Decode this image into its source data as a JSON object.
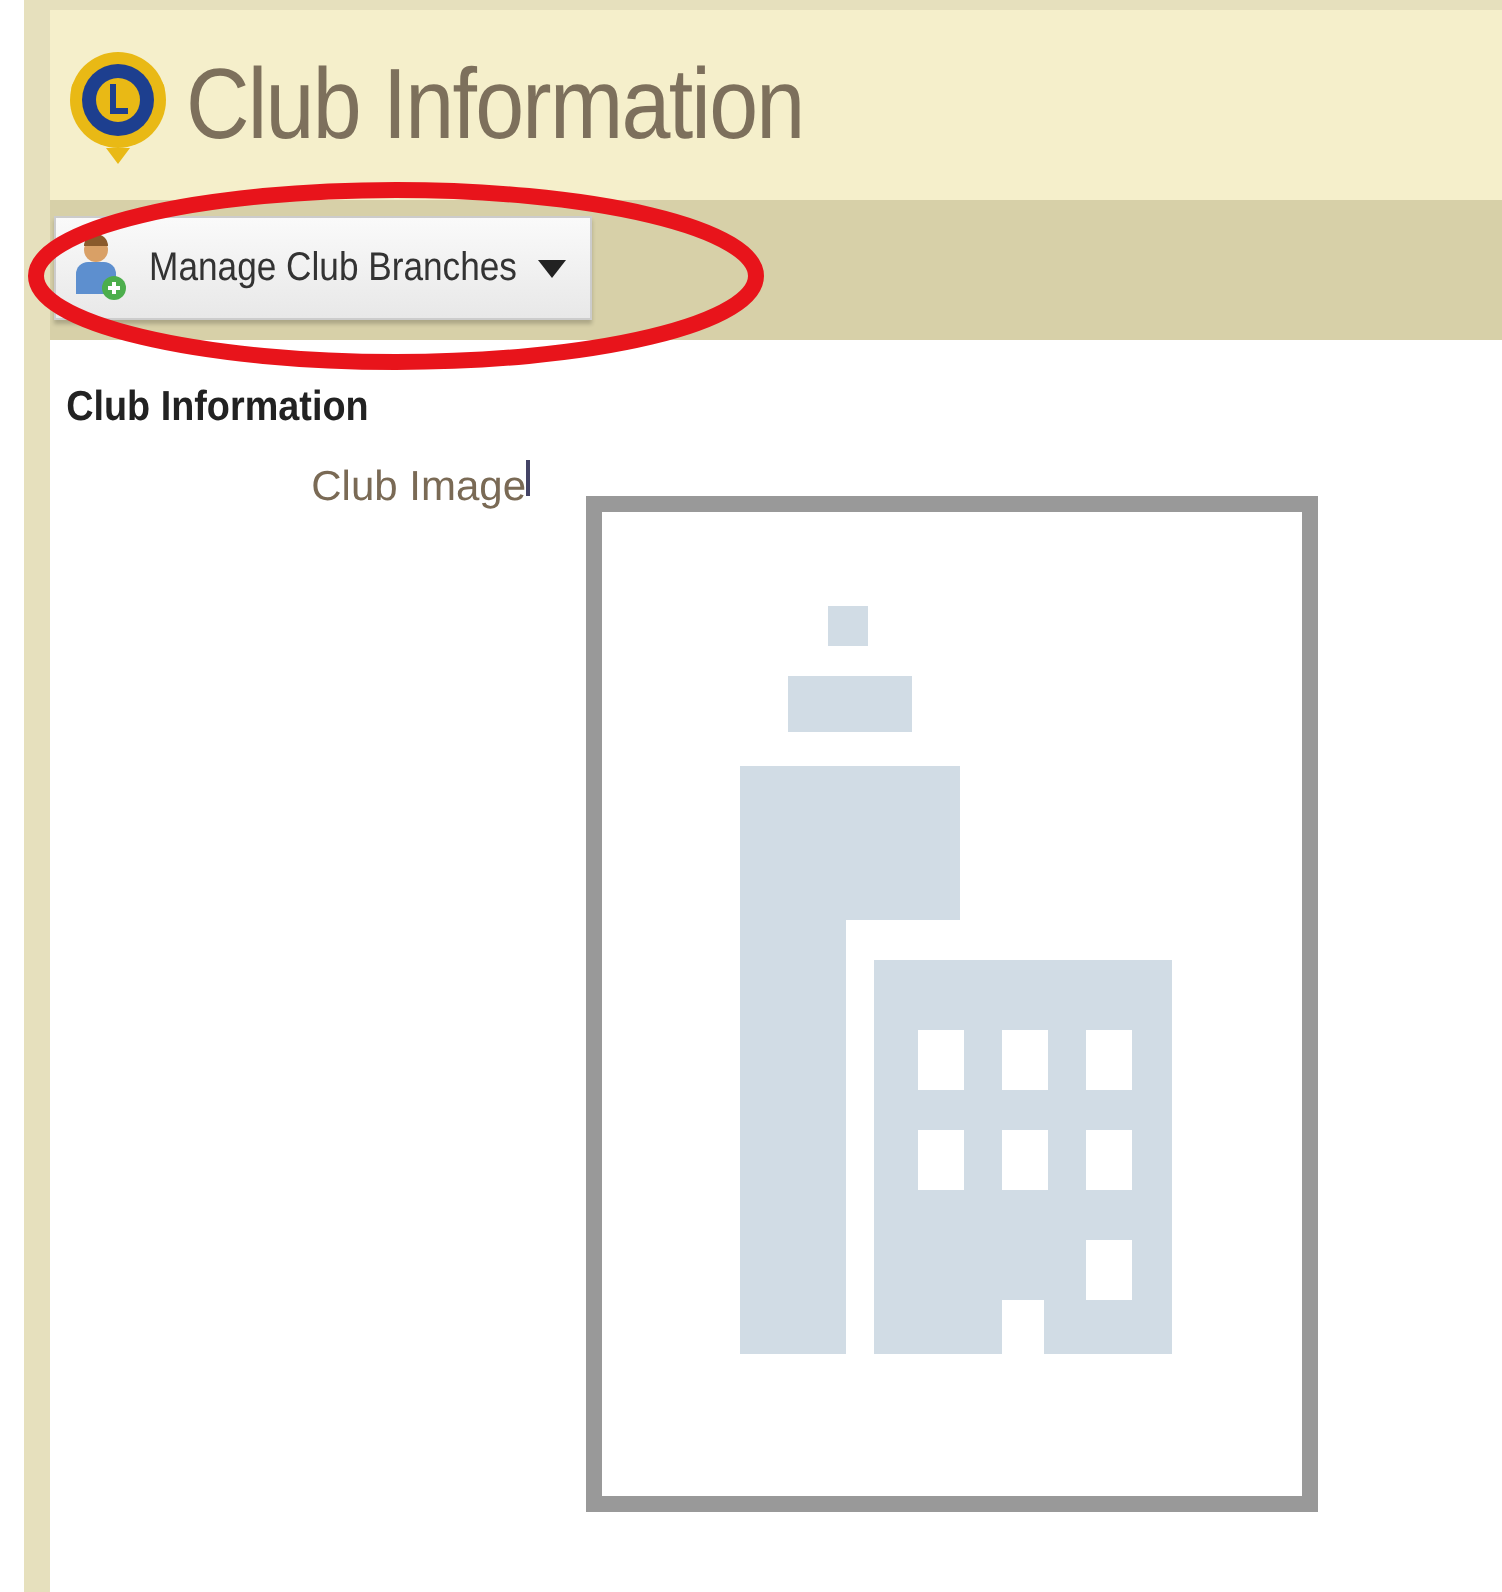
{
  "header": {
    "title": "Club Information"
  },
  "toolbar": {
    "buttons": [
      {
        "label": "Manage Club Branches",
        "kind": "dropdown"
      }
    ]
  },
  "section": {
    "heading": "Club Information",
    "fields": [
      {
        "label": "Club Image",
        "kind": "image"
      }
    ]
  }
}
